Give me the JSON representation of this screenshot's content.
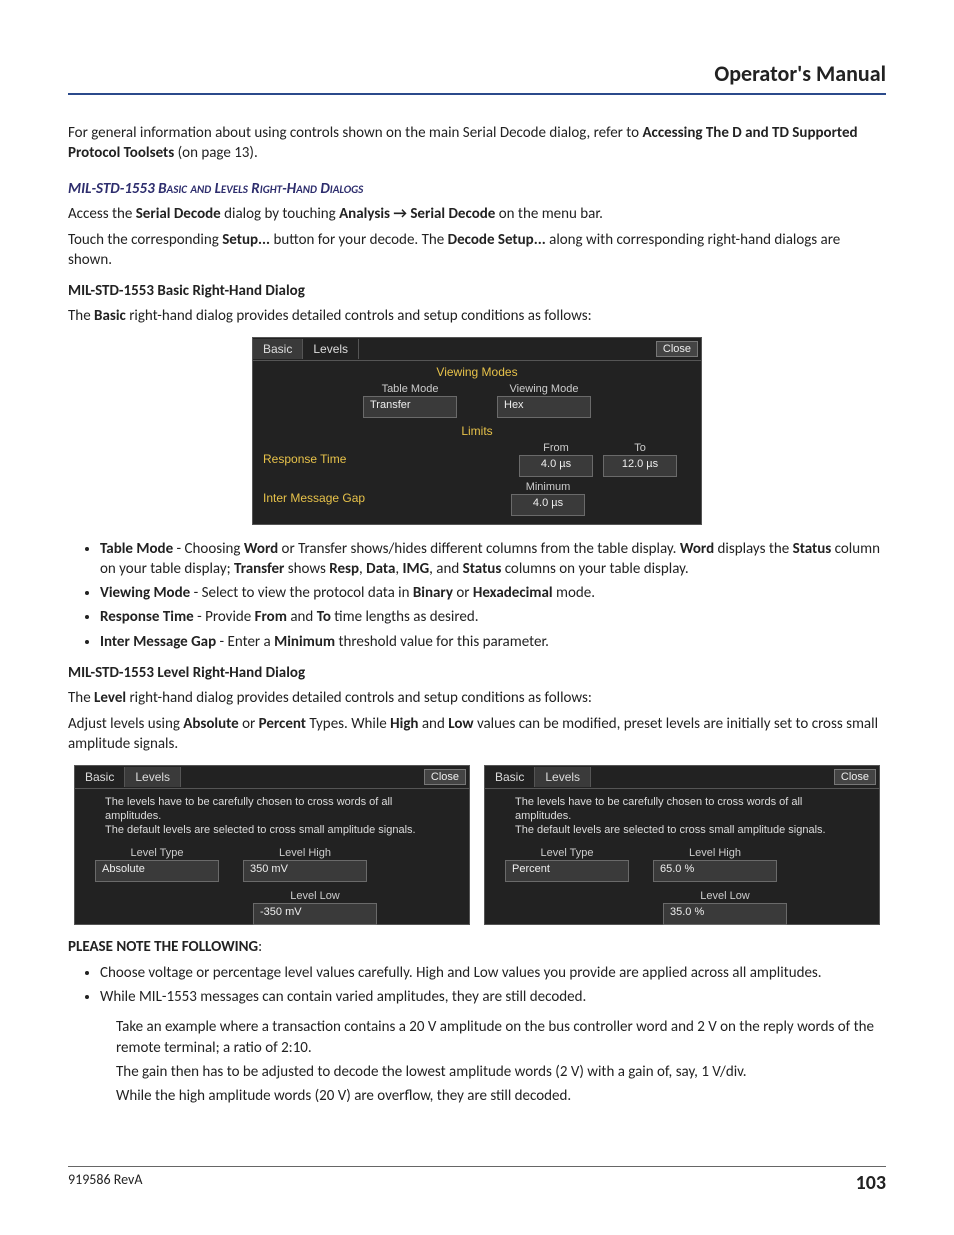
{
  "header": {
    "title": "Operator's Manual"
  },
  "intro": {
    "p1a": "For general information about using controls shown on the main Serial Decode dialog, refer to ",
    "p1b": "Accessing The D and TD Supported Protocol Toolsets",
    "p1c": " (on page 13)."
  },
  "sec1": {
    "heading_prefix": "MIL-STD-1553 ",
    "heading_rest": "Basic and Levels Right-Hand Dialogs",
    "p1a": "Access the ",
    "p1b": "Serial Decode",
    "p1c": " dialog by touching ",
    "p1d": "Analysis → Serial Decode",
    "p1e": " on the menu bar.",
    "p2a": "Touch the corresponding ",
    "p2b": "Setup...",
    "p2c": " button for your decode. The ",
    "p2d": "Decode Setup...",
    "p2e": " along with corresponding right-hand dialogs are shown."
  },
  "basic_section": {
    "heading": "MIL-STD-1553 Basic Right-Hand Dialog",
    "p1a": "The ",
    "p1b": "Basic",
    "p1c": " right-hand dialog provides detailed controls and setup conditions as follows:"
  },
  "dlg_basic": {
    "tab_basic": "Basic",
    "tab_levels": "Levels",
    "close": "Close",
    "viewing_modes_title": "Viewing Modes",
    "table_mode_label": "Table Mode",
    "table_mode_value": "Transfer",
    "viewing_mode_label": "Viewing Mode",
    "viewing_mode_value": "Hex",
    "limits_title": "Limits",
    "response_time_label": "Response Time",
    "from_label": "From",
    "from_value": "4.0 µs",
    "to_label": "To",
    "to_value": "12.0 µs",
    "imsg_label": "Inter Message Gap",
    "min_label": "Minimum",
    "min_value": "4.0 µs"
  },
  "bullets_basic": {
    "b1": {
      "t1": "Table Mode",
      "t2": " - Choosing ",
      "t3": "Word",
      "t4": " or Transfer shows/hides different columns from the table display. ",
      "t5": "Word",
      "t6": " displays the ",
      "t7": "Status",
      "t8": " column on your table display; ",
      "t9": "Transfer",
      "t10": " shows ",
      "t11": "Resp",
      "t12": ", ",
      "t13": "Data",
      "t14": ", ",
      "t15": "IMG",
      "t16": ", and ",
      "t17": "Status",
      "t18": " columns on your table display."
    },
    "b2": {
      "t1": "Viewing Mode",
      "t2": " - Select to view the protocol data in ",
      "t3": "Binary",
      "t4": " or ",
      "t5": "Hexadecimal",
      "t6": " mode."
    },
    "b3": {
      "t1": "Response Time",
      "t2": " - Provide ",
      "t3": "From",
      "t4": " and ",
      "t5": "To",
      "t6": " time lengths as desired."
    },
    "b4": {
      "t1": "Inter Message Gap",
      "t2": " - Enter a ",
      "t3": "Minimum",
      "t4": " threshold value for this parameter."
    }
  },
  "level_section": {
    "heading": "MIL-STD-1553 Level Right-Hand Dialog",
    "p1a": "The ",
    "p1b": "Level",
    "p1c": " right-hand dialog provides detailed controls and setup conditions as follows:",
    "p2a": "Adjust levels using ",
    "p2b": "Absolute",
    "p2c": " or ",
    "p2d": "Percent",
    "p2e": " Types. While ",
    "p2f": "High",
    "p2g": " and ",
    "p2h": "Low",
    "p2i": " values can be modified, preset levels are initially set to cross small amplitude signals."
  },
  "dlg_level_common": {
    "tab_basic": "Basic",
    "tab_levels": "Levels",
    "close": "Close",
    "hint_line1": "The levels have to be carefully chosen to cross words of all amplitudes.",
    "hint_line2": "The default levels are selected to cross small amplitude signals.",
    "type_label": "Level Type",
    "high_label": "Level High",
    "low_label": "Level Low"
  },
  "dlg_level_abs": {
    "type_value": "Absolute",
    "high_value": "350 mV",
    "low_value": "-350 mV"
  },
  "dlg_level_pct": {
    "type_value": "Percent",
    "high_value": "65.0 %",
    "low_value": "35.0 %"
  },
  "note_section": {
    "heading": "PLEASE NOTE THE FOLLOWING",
    "heading_colon": ":",
    "b1": "Choose voltage or percentage level values carefully. High and Low values you provide are applied across all amplitudes.",
    "b2": "While MIL-1553 messages can contain varied amplitudes, they are still decoded.",
    "p1": "Take an example where a transaction contains a 20 V amplitude on the bus controller word and 2 V on the reply words of the remote terminal; a ratio of 2:10.",
    "p2": "The gain then has to be adjusted to decode the lowest amplitude words (2 V) with a gain of, say, 1 V/div.",
    "p3": "While the high amplitude words (20 V) are overflow, they are still decoded."
  },
  "footer": {
    "left": "919586 RevA",
    "page": "103"
  }
}
